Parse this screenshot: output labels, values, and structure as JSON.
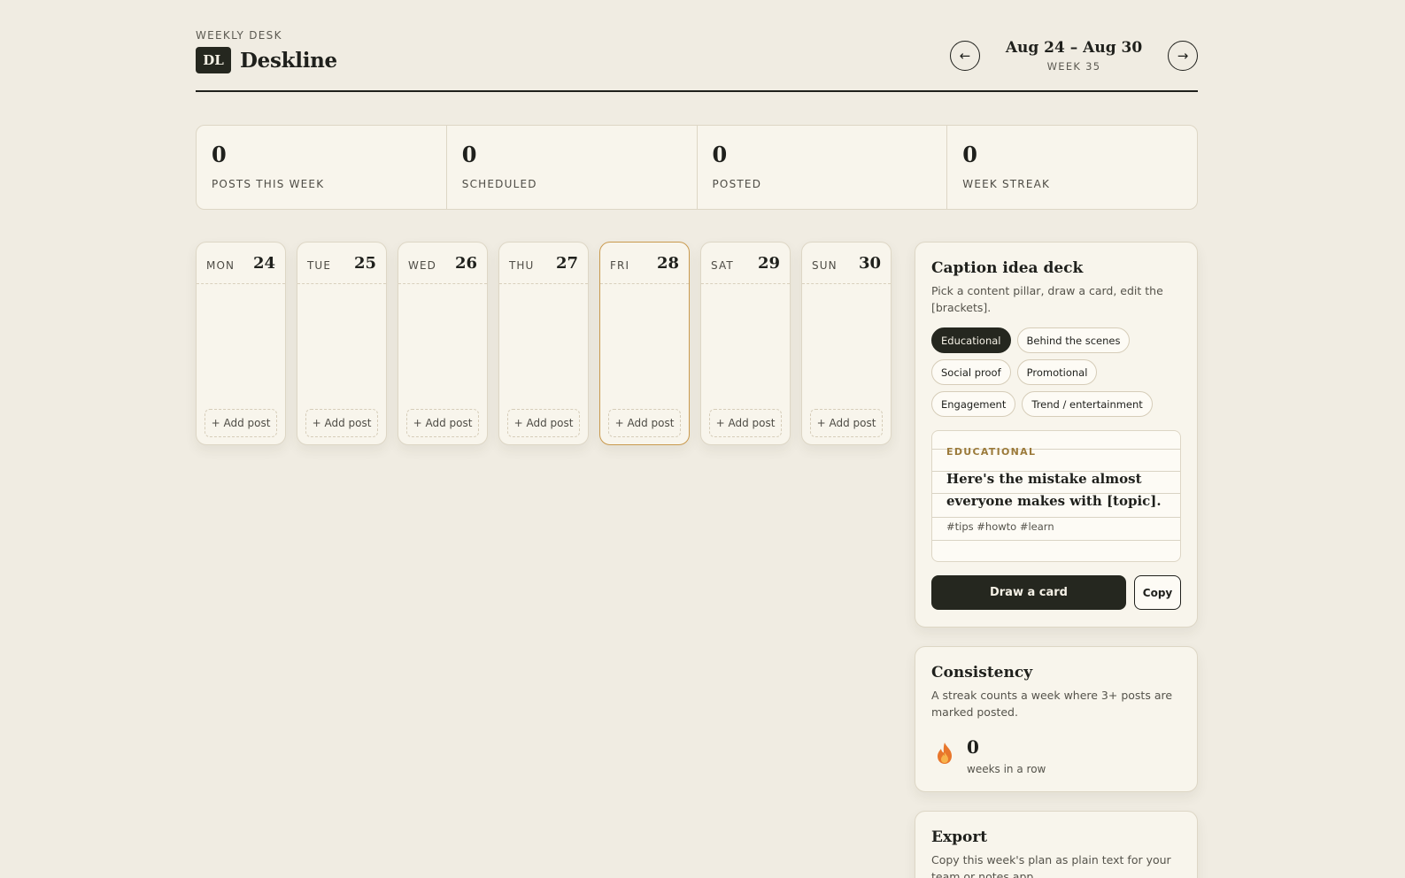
{
  "header": {
    "eyebrow": "WEEKLY DESK",
    "logo_badge": "DL",
    "app_title": "Deskline",
    "week_range": "Aug 24 – Aug 30",
    "week_number": "WEEK 35",
    "prev_label": "←",
    "next_label": "→"
  },
  "stats": [
    {
      "value": "0",
      "label": "POSTS THIS WEEK"
    },
    {
      "value": "0",
      "label": "SCHEDULED"
    },
    {
      "value": "0",
      "label": "POSTED"
    },
    {
      "value": "0",
      "label": "WEEK STREAK"
    }
  ],
  "days": [
    {
      "name": "MON",
      "date": "24",
      "add_label": "+ Add post"
    },
    {
      "name": "TUE",
      "date": "25",
      "add_label": "+ Add post"
    },
    {
      "name": "WED",
      "date": "26",
      "add_label": "+ Add post"
    },
    {
      "name": "THU",
      "date": "27",
      "add_label": "+ Add post"
    },
    {
      "name": "FRI",
      "date": "28",
      "add_label": "+ Add post",
      "today": true
    },
    {
      "name": "SAT",
      "date": "29",
      "add_label": "+ Add post"
    },
    {
      "name": "SUN",
      "date": "30",
      "add_label": "+ Add post"
    }
  ],
  "deck": {
    "title": "Caption idea deck",
    "subtitle": "Pick a content pillar, draw a card, edit the [brackets].",
    "pillars": [
      "Educational",
      "Behind the scenes",
      "Social proof",
      "Promotional",
      "Engagement",
      "Trend / entertainment"
    ],
    "active_pillar": "Educational",
    "card_tag": "EDUCATIONAL",
    "card_text": "Here's the mistake almost everyone makes with [topic].",
    "card_hashtags": "#tips #howto #learn",
    "draw_label": "Draw a card",
    "copy_label": "Copy"
  },
  "consistency": {
    "title": "Consistency",
    "subtitle": "A streak counts a week where 3+ posts are marked posted.",
    "streak_value": "0",
    "streak_label": "weeks in a row",
    "icon": "flame-icon"
  },
  "export": {
    "title": "Export",
    "subtitle": "Copy this week's plan as plain text for your team or notes app."
  },
  "colors": {
    "background": "#f0ece2",
    "ink": "#1f201c",
    "today_border": "#c99a4e",
    "tag_gold": "#9b7a3a"
  }
}
